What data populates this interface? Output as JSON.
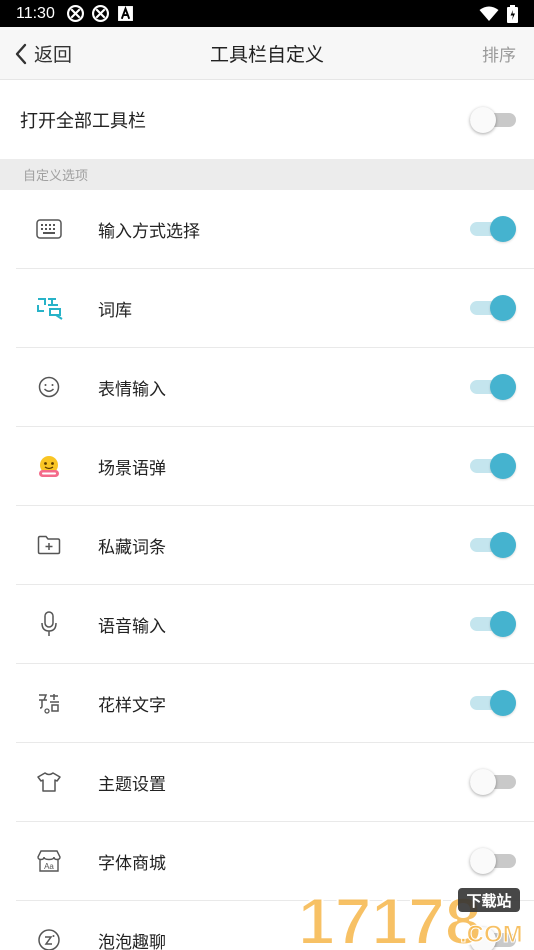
{
  "status_bar": {
    "time": "11:30"
  },
  "header": {
    "back_label": "返回",
    "title": "工具栏自定义",
    "sort_label": "排序"
  },
  "master": {
    "label": "打开全部工具栏",
    "enabled": false
  },
  "section": {
    "label": "自定义选项"
  },
  "items": [
    {
      "label": "输入方式选择",
      "icon": "keyboard-icon",
      "enabled": true
    },
    {
      "label": "词库",
      "icon": "lexicon-icon",
      "enabled": true
    },
    {
      "label": "表情输入",
      "icon": "smiley-icon",
      "enabled": true
    },
    {
      "label": "场景语弹",
      "icon": "scene-emoji-icon",
      "enabled": true
    },
    {
      "label": "私藏词条",
      "icon": "folder-plus-icon",
      "enabled": true
    },
    {
      "label": "语音输入",
      "icon": "microphone-icon",
      "enabled": true
    },
    {
      "label": "花样文字",
      "icon": "fancy-text-icon",
      "enabled": true
    },
    {
      "label": "主题设置",
      "icon": "tshirt-icon",
      "enabled": false
    },
    {
      "label": "字体商城",
      "icon": "font-store-icon",
      "enabled": false
    },
    {
      "label": "泡泡趣聊",
      "icon": "bubble-chat-icon",
      "enabled": false
    }
  ],
  "watermark": {
    "text": "17178",
    "badge": "下载站",
    "suffix": ".COM"
  },
  "colors": {
    "accent": "#45b3cf",
    "accent_track": "#c4e5ee"
  }
}
